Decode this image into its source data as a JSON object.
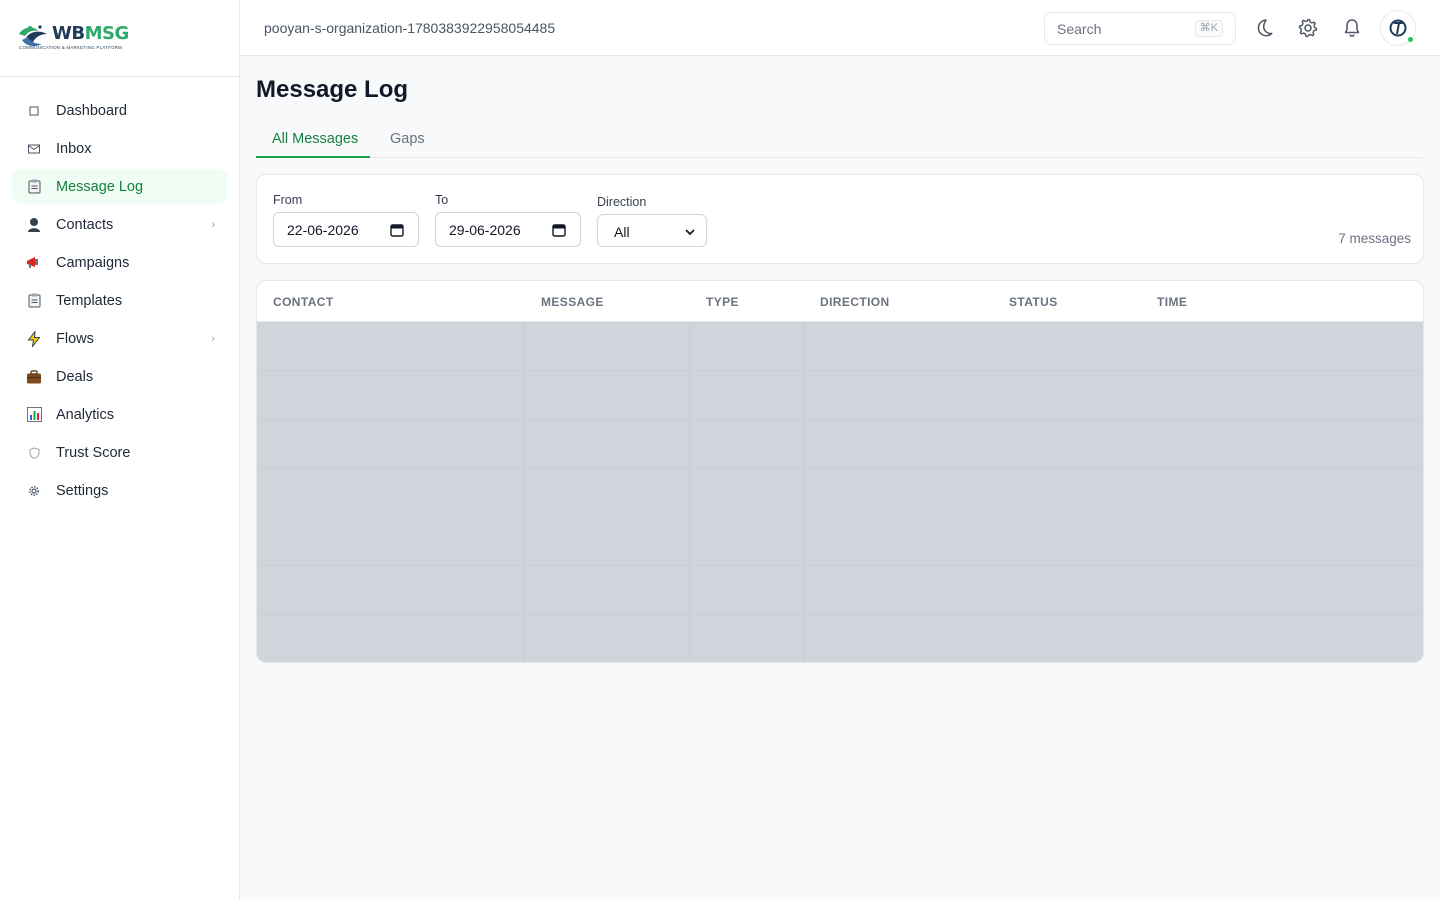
{
  "brand": {
    "wb": "WB",
    "msg": "MSG",
    "tagline": "COMMUNICATION & MARKETING PLATFORM"
  },
  "sidebar": {
    "items": [
      {
        "label": "Dashboard",
        "icon": "square-icon"
      },
      {
        "label": "Inbox",
        "icon": "envelope-icon"
      },
      {
        "label": "Message Log",
        "icon": "clipboard-icon",
        "active": true
      },
      {
        "label": "Contacts",
        "icon": "person-icon",
        "has_children": true
      },
      {
        "label": "Campaigns",
        "icon": "megaphone-icon"
      },
      {
        "label": "Templates",
        "icon": "clipboard-icon"
      },
      {
        "label": "Flows",
        "icon": "lightning-icon",
        "has_children": true
      },
      {
        "label": "Deals",
        "icon": "briefcase-icon"
      },
      {
        "label": "Analytics",
        "icon": "bar-chart-icon"
      },
      {
        "label": "Trust Score",
        "icon": "shield-icon"
      },
      {
        "label": "Settings",
        "icon": "gear-icon"
      }
    ]
  },
  "topbar": {
    "org_name": "pooyan-s-organization-1780383922958054485",
    "search_placeholder": "Search",
    "search_shortcut": "⌘K"
  },
  "page": {
    "title": "Message Log",
    "tabs": [
      {
        "label": "All Messages",
        "active": true
      },
      {
        "label": "Gaps",
        "active": false
      }
    ]
  },
  "filters": {
    "from_label": "From",
    "from_value": "22-06-2026",
    "to_label": "To",
    "to_value": "29-06-2026",
    "direction_label": "Direction",
    "direction_value": "All",
    "message_count": "7 messages"
  },
  "table": {
    "columns": [
      "CONTACT",
      "MESSAGE",
      "TYPE",
      "DIRECTION",
      "STATUS",
      "TIME"
    ]
  },
  "colors": {
    "accent": "#15803d",
    "active_bg": "#f0fdf4",
    "skeleton": "#d1d5db"
  }
}
